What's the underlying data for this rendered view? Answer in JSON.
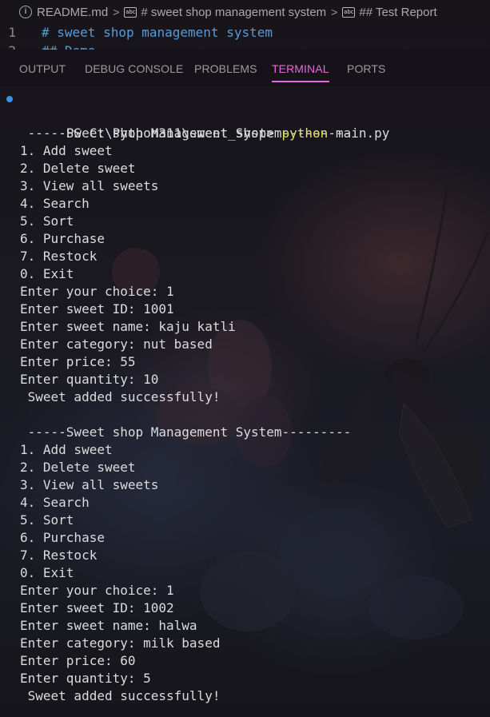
{
  "breadcrumb": {
    "file": "README.md",
    "crumb1": "# sweet shop management system",
    "crumb2": "## Test Report"
  },
  "editor": {
    "lines": [
      {
        "num": "1",
        "text": "# sweet shop management system"
      },
      {
        "num": "2",
        "text": "## Demo"
      }
    ]
  },
  "panel": {
    "tabs": [
      "OUTPUT",
      "DEBUG CONSOLE",
      "PROBLEMS",
      "TERMINAL",
      "PORTS"
    ],
    "active_tab": "TERMINAL"
  },
  "terminal": {
    "prompt": "PS C:\\Python311\\sweet_shop> ",
    "command": "python",
    "args": " main.py",
    "lines": [
      "",
      " -----Sweet shop Management System---------",
      "1. Add sweet",
      "2. Delete sweet",
      "3. View all sweets",
      "4. Search",
      "5. Sort",
      "6. Purchase",
      "7. Restock",
      "0. Exit",
      "Enter your choice: 1",
      "Enter sweet ID: 1001",
      "Enter sweet name: kaju katli",
      "Enter category: nut based",
      "Enter price: 55",
      "Enter quantity: 10",
      " Sweet added successfully!",
      "",
      " -----Sweet shop Management System---------",
      "1. Add sweet",
      "2. Delete sweet",
      "3. View all sweets",
      "4. Search",
      "5. Sort",
      "6. Purchase",
      "7. Restock",
      "0. Exit",
      "Enter your choice: 1",
      "Enter sweet ID: 1002",
      "Enter sweet name: halwa",
      "Enter category: milk based",
      "Enter price: 60",
      "Enter quantity: 5",
      " Sweet added successfully!"
    ]
  },
  "colors": {
    "accent": "#e56bd8",
    "command": "#e5e06e",
    "heading": "#569cd6",
    "status_dot": "#3b8eea"
  }
}
